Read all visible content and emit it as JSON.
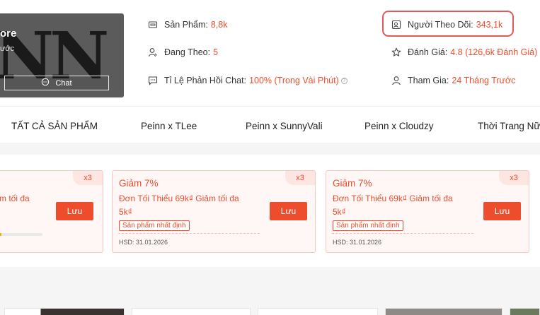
{
  "shop": {
    "name_fragment": "ore",
    "sub_fragment": "ước",
    "logo_text": "NN",
    "chat_label": "Chat"
  },
  "stats": {
    "products": {
      "label": "Sản Phẩm:",
      "value": "8,8k",
      "icon": "store-icon"
    },
    "following": {
      "label": "Đang Theo:",
      "value": "5",
      "icon": "user-follow-icon"
    },
    "chat_response": {
      "label": "Tỉ Lệ Phản Hồi Chat:",
      "value": "100% (Trong Vài Phút)",
      "icon": "chat-bubble-icon"
    },
    "followers": {
      "label": "Người Theo Dõi:",
      "value": "343,1k",
      "icon": "followers-icon"
    },
    "rating": {
      "label": "Đánh Giá:",
      "value": "4.8 (126,6k Đánh Giá)",
      "icon": "star-icon"
    },
    "joined": {
      "label": "Tham Gia:",
      "value": "24 Tháng Trước",
      "icon": "user-icon"
    }
  },
  "tabs": [
    "TẤT CẢ SẢN PHẨM",
    "Peinn x TLee",
    "Peinn x SunnyVali",
    "Peinn x Cloudzy",
    "Thời Trang Nữ"
  ],
  "vouchers": [
    {
      "percent": "",
      "line1": "m tối đa",
      "line2": "",
      "tag": "",
      "expiry": "",
      "multiplier": "x3",
      "save_label": "Lưu",
      "progress": 0.05
    },
    {
      "percent": "Giảm 7%",
      "line1": "Đơn Tối Thiểu 69k₫ Giảm tối đa",
      "line2": "5k₫",
      "tag": "Sản phẩm nhất định",
      "expiry": "HSD: 31.01.2026",
      "multiplier": "x3",
      "save_label": "Lưu"
    },
    {
      "percent": "Giảm 7%",
      "line1": "Đơn Tối Thiểu 69k₫ Giảm tối đa",
      "line2": "5k₫",
      "tag": "Sản phẩm nhất định",
      "expiry": "HSD: 31.01.2026",
      "multiplier": "x3",
      "save_label": "Lưu"
    }
  ],
  "colors": {
    "accent": "#ee4d2d",
    "highlight_outline": "#e05a5a",
    "voucher_bg": "#fff7f5"
  }
}
